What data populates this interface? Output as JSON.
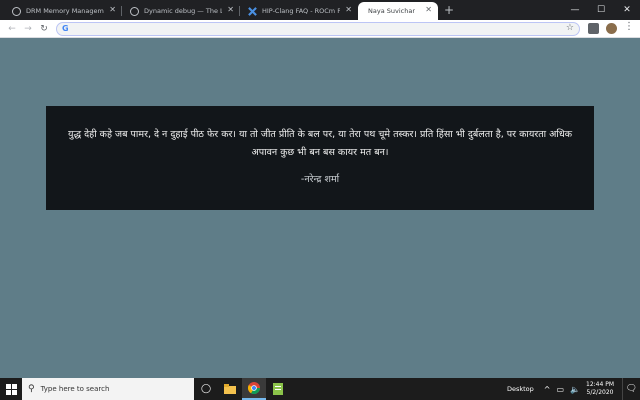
{
  "browser": {
    "tabs": [
      {
        "title": "DRM Memory Management — The",
        "icon": "globe-icon",
        "active": false
      },
      {
        "title": "Dynamic debug — The Linux Ker",
        "icon": "globe-icon",
        "active": false
      },
      {
        "title": "HIP-Clang FAQ - ROCm Platform",
        "icon": "rocm-icon",
        "active": false
      },
      {
        "title": "Naya Suvichar",
        "icon": "",
        "active": true
      }
    ],
    "new_tab": "+",
    "address": {
      "value": "",
      "placeholder": ""
    },
    "window_controls": {
      "minimize": "—",
      "maximize": "☐",
      "close": "✕"
    }
  },
  "quote": {
    "text": "युद्ध देही कहे जब पामर, दे न दुहाई पीठ फेर कर। या तो जीत प्रीति के बल पर, या तेरा पथ चूमे तस्कर। प्रति हिंसा भी दुर्बलता है, पर कायरता अधिक अपावन कुछ भी बन बस कायर मत बन।",
    "author": "-नरेन्द्र शर्मा"
  },
  "taskbar": {
    "search_placeholder": "Type here to search",
    "desktop_label": "Desktop",
    "time": "12:44 PM",
    "date": "5/2/2020"
  },
  "colors": {
    "page_background": "#5f7d88",
    "card_background": "#12161a",
    "tab_strip": "#202124"
  }
}
